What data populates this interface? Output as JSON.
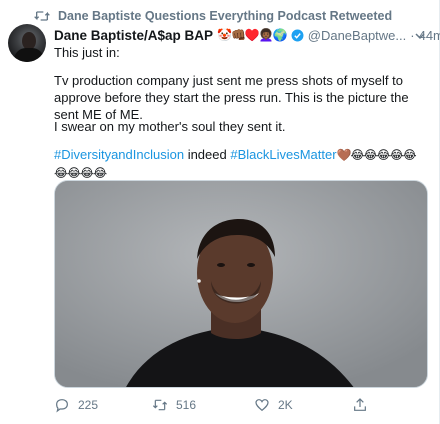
{
  "retweet_line": {
    "text": "Dane Baptiste Questions Everything Podcast Retweeted",
    "icon": "retweet-icon"
  },
  "tweet": {
    "author_name": "Dane Baptiste/A$ap BAP",
    "author_emojis": "🤡👊🏾♥️👩🏾‍🦱🌍",
    "handle": "@DaneBaptwe...",
    "separator": "·",
    "time": "44m",
    "line1": "This just in:",
    "line2": "Tv production company just sent me press shots of myself to approve before they start the press run. This is the picture the sent ME of ME.",
    "line3": "I swear on my mother's soul they sent it.",
    "hashtag1": "#DiversityandInclusion",
    "mid_word": " indeed ",
    "hashtag2": "#BlackLivesMatter",
    "trailing_emojis": "🤎😂😂😂😂😂😂😂😂😂",
    "accent_color": "#1b95e0"
  },
  "actions": {
    "reply_count": "225",
    "retweet_count": "516",
    "like_count": "2K"
  }
}
